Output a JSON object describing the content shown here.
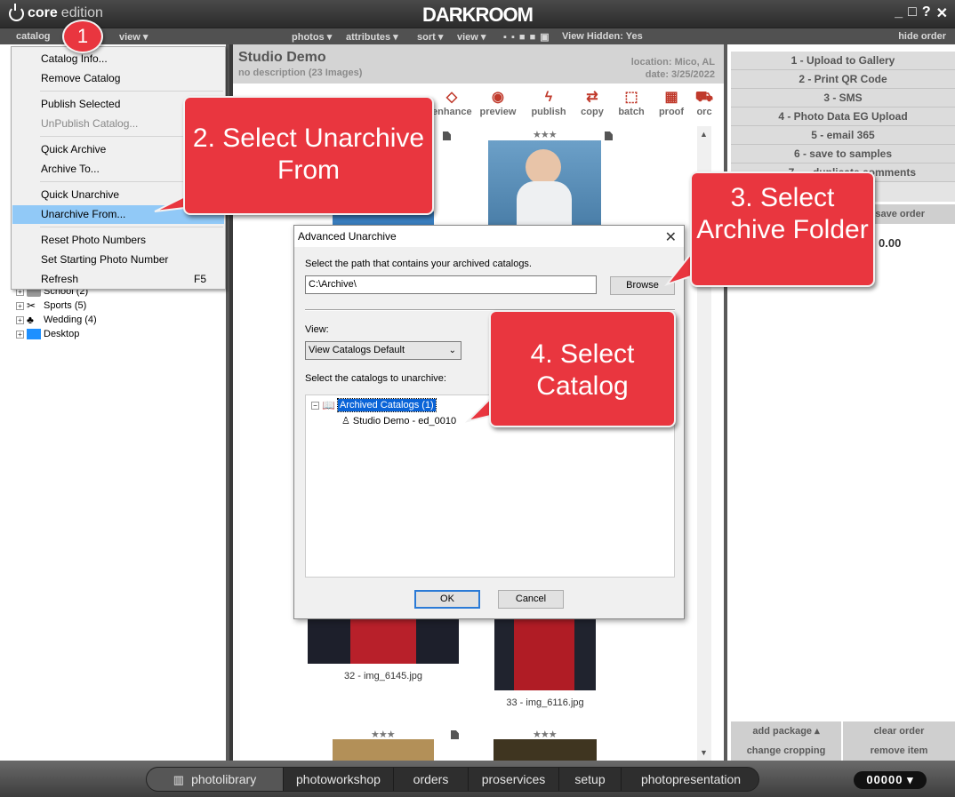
{
  "app": {
    "logo_bold": "core",
    "logo_light": "edition",
    "brand": "DARKROOM",
    "window_controls": [
      "_",
      "□",
      "?",
      "✕"
    ]
  },
  "menubar": {
    "catalog": "catalog",
    "left_view": "view ▾",
    "photos": "photos ▾",
    "attributes": "attributes ▾",
    "sort": "sort ▾",
    "view": "view ▾",
    "view_hidden": "View Hidden: Yes",
    "hide_order": "hide order"
  },
  "catalog_menu": {
    "items": [
      {
        "label": "Catalog Info...",
        "shortcut": "",
        "disabled": false
      },
      {
        "label": "Remove Catalog",
        "shortcut": "",
        "disabled": false
      },
      {
        "label": "Publish Selected",
        "shortcut": "",
        "disabled": false
      },
      {
        "label": "UnPublish Catalog...",
        "shortcut": "",
        "disabled": true
      },
      {
        "label": "Quick Archive",
        "shortcut": "",
        "disabled": false
      },
      {
        "label": "Archive To...",
        "shortcut": "",
        "disabled": false
      },
      {
        "label": "Quick Unarchive",
        "shortcut": "",
        "disabled": false
      },
      {
        "label": "Unarchive From...",
        "shortcut": "",
        "disabled": false,
        "selected": true
      },
      {
        "label": "Reset Photo Numbers",
        "shortcut": "",
        "disabled": false
      },
      {
        "label": "Set Starting Photo Number",
        "shortcut": "",
        "disabled": false
      },
      {
        "label": "Refresh",
        "shortcut": "F5",
        "disabled": false
      }
    ]
  },
  "tree": [
    {
      "label": "School (2)"
    },
    {
      "label": "Sports (5)"
    },
    {
      "label": "Wedding (4)"
    },
    {
      "label": "Desktop"
    }
  ],
  "catalog": {
    "title": "Studio Demo",
    "description": "no description (23 Images)",
    "location": "location: Mico, AL",
    "date": "date: 3/25/2022"
  },
  "toolbar": {
    "tools": [
      "enhance",
      "preview",
      "publish",
      "copy",
      "batch",
      "proof",
      "orc"
    ]
  },
  "photos": {
    "stars": "★★★",
    "captions": [
      "32 - img_6145.jpg",
      "33 - img_6116.jpg"
    ]
  },
  "right_tasks": [
    "1 - Upload to Gallery",
    "2 - Print QR Code",
    "3 - SMS",
    "4 - Photo Data EG Upload",
    "5 - email 365",
    "6 - save to samples",
    "7 - ...duplicate comments"
  ],
  "right_panel": {
    "save_order": "save order",
    "amount": "0.00",
    "add_package": "add package ▴",
    "clear_order": "clear order",
    "change_cropping": "change cropping",
    "remove_item": "remove item"
  },
  "bottom_nav": {
    "items": [
      "photolibrary",
      "photoworkshop",
      "orders",
      "proservices",
      "setup",
      "photopresentation"
    ],
    "counter": "00000 ▾"
  },
  "dialog": {
    "title": "Advanced Unarchive",
    "path_prompt": "Select the path that contains your archived catalogs.",
    "path_value": "C:\\Archive\\",
    "browse": "Browse",
    "view_label": "View:",
    "view_value": "View Catalogs Default",
    "select_prompt": "Select the catalogs to unarchive:",
    "root_node": "Archived Catalogs (1)",
    "child_node": "Studio Demo - ed_0010",
    "ok": "OK",
    "cancel": "Cancel"
  },
  "callouts": {
    "step1": "1",
    "step2": "2. Select Unarchive From",
    "step3": "3. Select Archive Folder",
    "step4": "4. Select Catalog",
    "color": "#e9363f"
  }
}
